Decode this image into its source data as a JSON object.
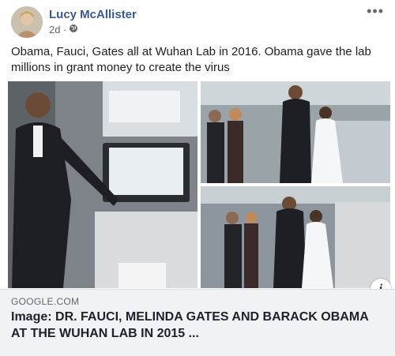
{
  "post": {
    "author": "Lucy McAllister",
    "time": "2d ·",
    "privacy_icon": "globe-icon",
    "more_icon": "more-options-icon",
    "text": "Obama, Fauci, Gates all at Wuhan Lab in 2016. Obama gave the lab millions in grant money to create the virus"
  },
  "link_preview": {
    "domain": "GOOGLE.COM",
    "title": "Image: DR. FAUCI, MELINDA GATES AND BARACK OBAMA AT THE WUHAN LAB IN 2015 ...",
    "info_icon": "info-icon"
  }
}
